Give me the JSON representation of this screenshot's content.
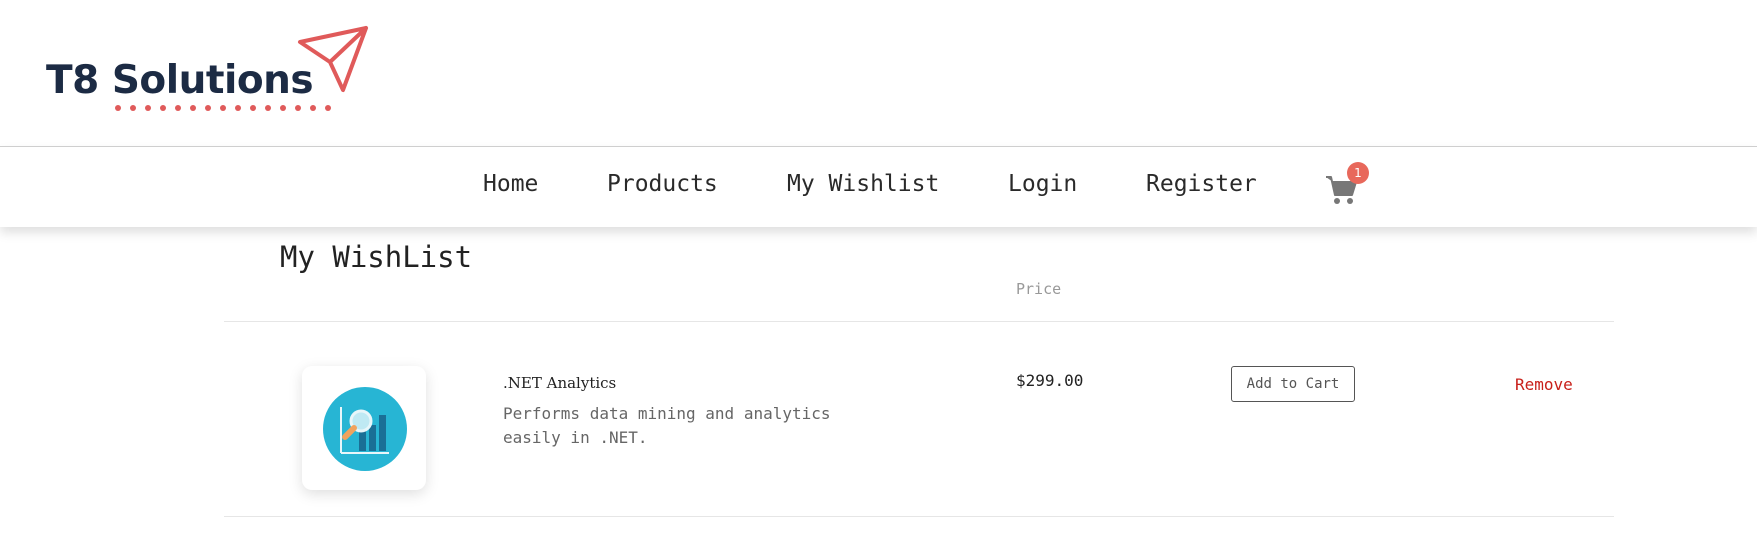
{
  "brand": {
    "name": "T8 Solutions",
    "accent_color": "#e05a5a",
    "text_color": "#1c2b44"
  },
  "nav": {
    "items": [
      {
        "label": "Home"
      },
      {
        "label": "Products"
      },
      {
        "label": "My Wishlist"
      },
      {
        "label": "Login"
      },
      {
        "label": "Register"
      }
    ],
    "cart": {
      "icon": "cart-icon",
      "count": "1"
    }
  },
  "page": {
    "title": "My WishList"
  },
  "table": {
    "columns": {
      "price": "Price"
    },
    "rows": [
      {
        "name": ".NET Analytics",
        "description": "Performs data mining and analytics easily in .NET.",
        "price": "$299.00",
        "add_label": "Add to Cart",
        "remove_label": "Remove",
        "icon": "analytics-icon"
      }
    ]
  }
}
